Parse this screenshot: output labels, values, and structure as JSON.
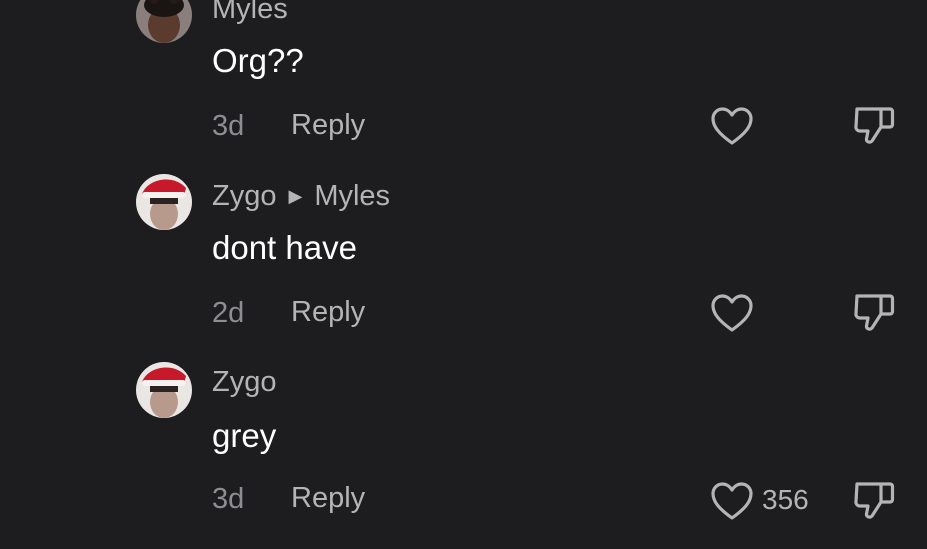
{
  "comments": [
    {
      "author": "Myles",
      "reply_to": "",
      "text": "Org??",
      "time": "3d",
      "reply_label": "Reply",
      "like_count": ""
    },
    {
      "author": "Zygo",
      "reply_to": "Myles",
      "text": "dont have",
      "time": "2d",
      "reply_label": "Reply",
      "like_count": ""
    },
    {
      "author": "Zygo",
      "reply_to": "",
      "text": "grey",
      "time": "3d",
      "reply_label": "Reply",
      "like_count": "356"
    }
  ],
  "icons": {
    "like": "heart-outline-icon",
    "dislike": "thumbs-down-outline-icon",
    "reply_arrow": "caret-right-icon"
  },
  "colors": {
    "background": "#1d1c1e",
    "text": "#ffffff",
    "secondary": "#b4b4b6",
    "muted": "#8e8d91"
  }
}
